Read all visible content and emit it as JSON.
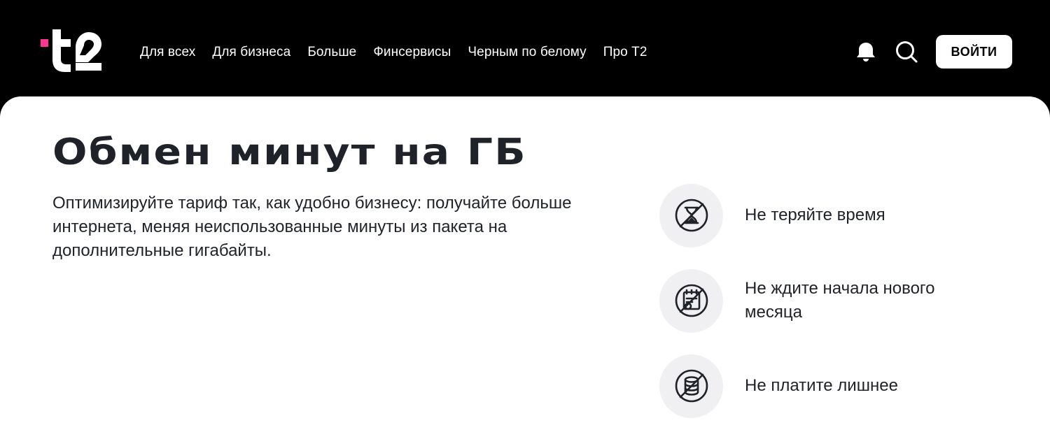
{
  "header": {
    "logo_alt": "t2",
    "nav": [
      {
        "label": "Для всех"
      },
      {
        "label": "Для бизнеса"
      },
      {
        "label": "Больше"
      },
      {
        "label": "Финсервисы"
      },
      {
        "label": "Черным по белому"
      },
      {
        "label": "Про Т2"
      }
    ],
    "bell_icon": "bell-icon",
    "search_icon": "search-icon",
    "login_label": "ВОЙТИ"
  },
  "main": {
    "title": "Обмен минут на ГБ",
    "description": "Оптимизируйте тариф так, как удобно бизнесу: получайте больше интернета, меняя неиспользованные минуты из пакета на дополнительные гигабайты.",
    "features": [
      {
        "icon": "crossed-hourglass-icon",
        "text": "Не теряйте время"
      },
      {
        "icon": "crossed-calendar-icon",
        "text": "Не ждите начала нового месяца"
      },
      {
        "icon": "crossed-coins-icon",
        "text": "Не платите лишнее"
      }
    ]
  },
  "colors": {
    "header_bg": "#000000",
    "accent_pink": "#ff3495",
    "text_dark": "#1f2229",
    "icon_circle_bg": "#f0f0f2"
  }
}
